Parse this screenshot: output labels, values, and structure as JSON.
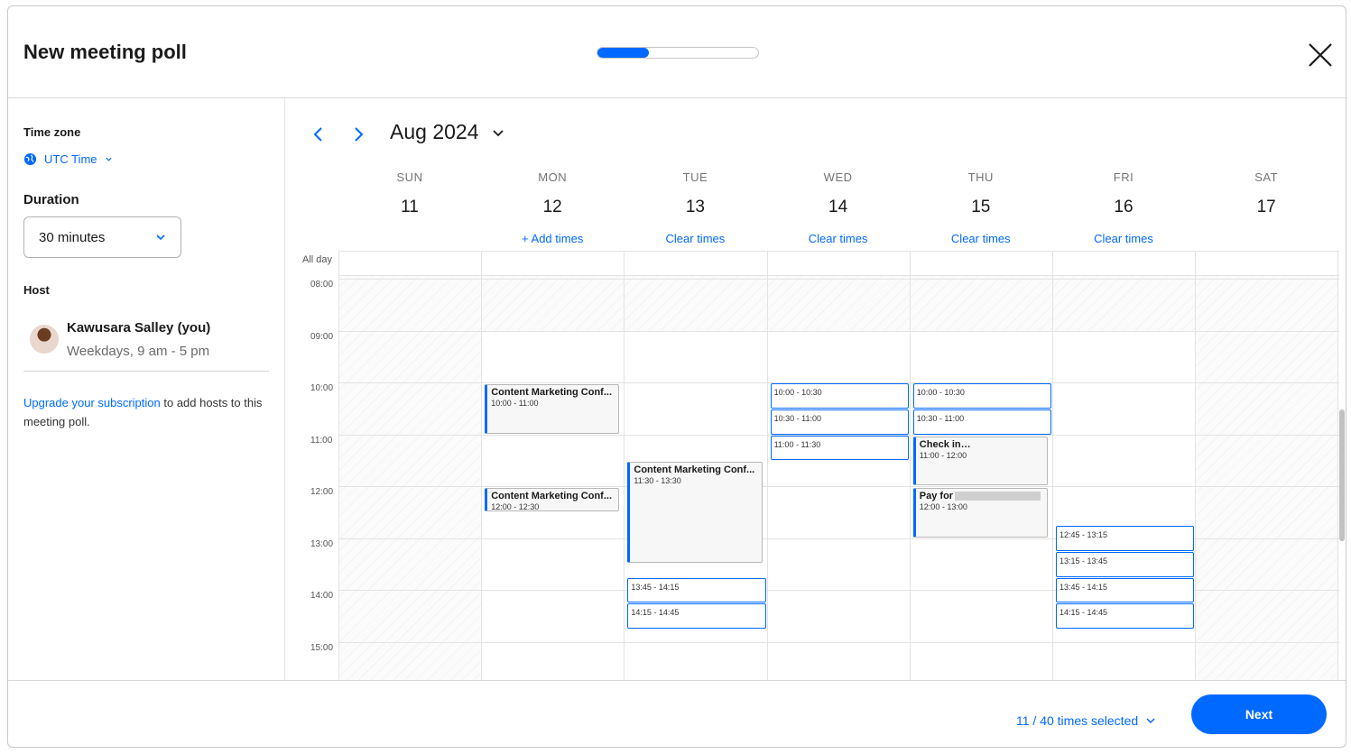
{
  "header": {
    "title": "New meeting poll",
    "progress": 0.32
  },
  "sidebar": {
    "timezone_label": "Time zone",
    "timezone_value": "UTC Time",
    "duration_label": "Duration",
    "duration_value": "30 minutes",
    "host_label": "Host",
    "host_name": "Kawusara Salley (you)",
    "host_hours": "Weekdays, 9 am - 5 pm",
    "upgrade_link": "Upgrade your subscription",
    "upgrade_text": " to add hosts to this meeting poll."
  },
  "calendar": {
    "month": "Aug 2024",
    "days": [
      {
        "name": "SUN",
        "num": "11",
        "action": ""
      },
      {
        "name": "MON",
        "num": "12",
        "action": "+ Add times"
      },
      {
        "name": "TUE",
        "num": "13",
        "action": "Clear times"
      },
      {
        "name": "WED",
        "num": "14",
        "action": "Clear times"
      },
      {
        "name": "THU",
        "num": "15",
        "action": "Clear times"
      },
      {
        "name": "FRI",
        "num": "16",
        "action": "Clear times"
      },
      {
        "name": "SAT",
        "num": "17",
        "action": ""
      }
    ],
    "allday_label": "All day",
    "hours": [
      "08:00",
      "09:00",
      "10:00",
      "11:00",
      "12:00",
      "13:00",
      "14:00",
      "15:00"
    ],
    "events": [
      {
        "day": 1,
        "title": "Content Marketing Conf...",
        "time": "10:00 - 11:00"
      },
      {
        "day": 1,
        "title": "Content Marketing Conf...",
        "time": "12:00 - 12:30"
      },
      {
        "day": 2,
        "title": "Content Marketing Conf...",
        "time": "11:30 - 13:30"
      },
      {
        "day": 4,
        "title": "Check in",
        "time": "11:00 - 12:00"
      },
      {
        "day": 4,
        "title": "Pay for",
        "time": "12:00 - 13:00"
      }
    ],
    "slots": [
      {
        "day": 2,
        "time": "13:45 - 14:15"
      },
      {
        "day": 2,
        "time": "14:15 - 14:45"
      },
      {
        "day": 3,
        "time": "10:00 - 10:30"
      },
      {
        "day": 3,
        "time": "10:30 - 11:00"
      },
      {
        "day": 3,
        "time": "11:00 - 11:30"
      },
      {
        "day": 4,
        "time": "10:00 - 10:30"
      },
      {
        "day": 4,
        "time": "10:30 - 11:00"
      },
      {
        "day": 5,
        "time": "12:45 - 13:15"
      },
      {
        "day": 5,
        "time": "13:15 - 13:45"
      },
      {
        "day": 5,
        "time": "13:45 - 14:15"
      },
      {
        "day": 5,
        "time": "14:15 - 14:45"
      }
    ]
  },
  "footer": {
    "selected": "11 / 40 times selected",
    "next_label": "Next"
  },
  "colors": {
    "accent": "#0069ff"
  }
}
